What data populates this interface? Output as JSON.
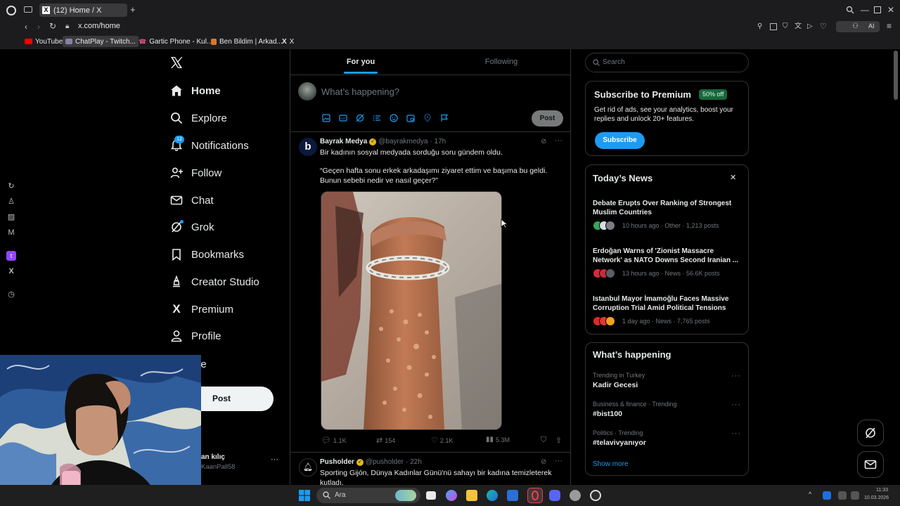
{
  "browser": {
    "tabs": [
      {
        "label": "(12) Home / X"
      }
    ],
    "url": "x.com/home",
    "bookmarks": [
      {
        "label": "YouTube",
        "icon": "youtube-icon"
      },
      {
        "label": "ChatPlay - Twitch...",
        "icon": "chatplay-icon"
      },
      {
        "label": "Gartic Phone - Kul...",
        "icon": "phone-icon"
      },
      {
        "label": "Ben Bildim | Arkad...",
        "icon": "game-icon"
      },
      {
        "label": "X",
        "icon": "x-logo-icon"
      }
    ],
    "ai_label": "AI"
  },
  "nav": {
    "items": [
      {
        "label": "Home",
        "icon": "home-icon"
      },
      {
        "label": "Explore",
        "icon": "search-icon"
      },
      {
        "label": "Notifications",
        "icon": "bell-icon",
        "badge": "12"
      },
      {
        "label": "Follow",
        "icon": "follow-icon"
      },
      {
        "label": "Chat",
        "icon": "mail-icon"
      },
      {
        "label": "Grok",
        "icon": "grok-icon"
      },
      {
        "label": "Bookmarks",
        "icon": "bookmark-icon"
      },
      {
        "label": "Creator Studio",
        "icon": "creator-icon"
      },
      {
        "label": "Premium",
        "icon": "x-logo-icon"
      },
      {
        "label": "Profile",
        "icon": "person-icon"
      },
      {
        "label": "ore",
        "icon": "more-icon"
      }
    ],
    "post_button": "Post",
    "account": {
      "name": "an kılıç",
      "handle": "KaanPall58"
    }
  },
  "timeline": {
    "tabs": [
      "For you",
      "Following"
    ],
    "composer_placeholder": "What’s happening?",
    "post_button": "Post",
    "tweets": [
      {
        "name": "Bayrak Medya",
        "handle": "@bayrakmedya",
        "time": "· 17h",
        "text1": "Bir kadının sosyal medyada sorduğu soru gündem oldu.",
        "text2": "“Geçen hafta sonu erkek arkadaşımı ziyaret ettim ve başıma bu geldi. Bunun sebebi nedir ve nasıl geçer?”",
        "replies": "1.1K",
        "reposts": "154",
        "likes": "2.1K",
        "views": "5.3M"
      },
      {
        "name": "Pusholder",
        "handle": "@pusholder",
        "time": "· 22h",
        "text1": "Sporting Gijón, Dünya Kadınlar Günü'nü sahayı bir kadına temizleterek kutladı."
      }
    ]
  },
  "right": {
    "search_placeholder": "Search",
    "premium": {
      "title": "Subscribe to Premium",
      "badge": "50% off",
      "desc": "Get rid of ads, see your analytics, boost your replies and unlock 20+ features.",
      "button": "Subscribe"
    },
    "news": {
      "title": "Today’s News",
      "items": [
        {
          "title": "Debate Erupts Over Ranking of Strongest Muslim Countries",
          "meta": "10 hours ago · Other · 1,213 posts"
        },
        {
          "title": "Erdoğan Warns of 'Zionist Massacre Network' as NATO Downs Second Iranian ...",
          "meta": "13 hours ago · News · 56.6K posts"
        },
        {
          "title": "Istanbul Mayor İmamoğlu Faces Massive Corruption Trial Amid Political Tensions",
          "meta": "1 day ago · News · 7,765 posts"
        }
      ]
    },
    "happening": {
      "title": "What’s happening",
      "items": [
        {
          "category": "Trending in Turkey",
          "name": "Kadir Gecesi"
        },
        {
          "category": "Business & finance · Trending",
          "name": "#bist100"
        },
        {
          "category": "Politics · Trending",
          "name": "#telavivyanıyor"
        }
      ],
      "show_more": "Show more"
    }
  },
  "taskbar": {
    "search_placeholder": "Ara",
    "time": "11:33",
    "date": "10.03.2026"
  }
}
